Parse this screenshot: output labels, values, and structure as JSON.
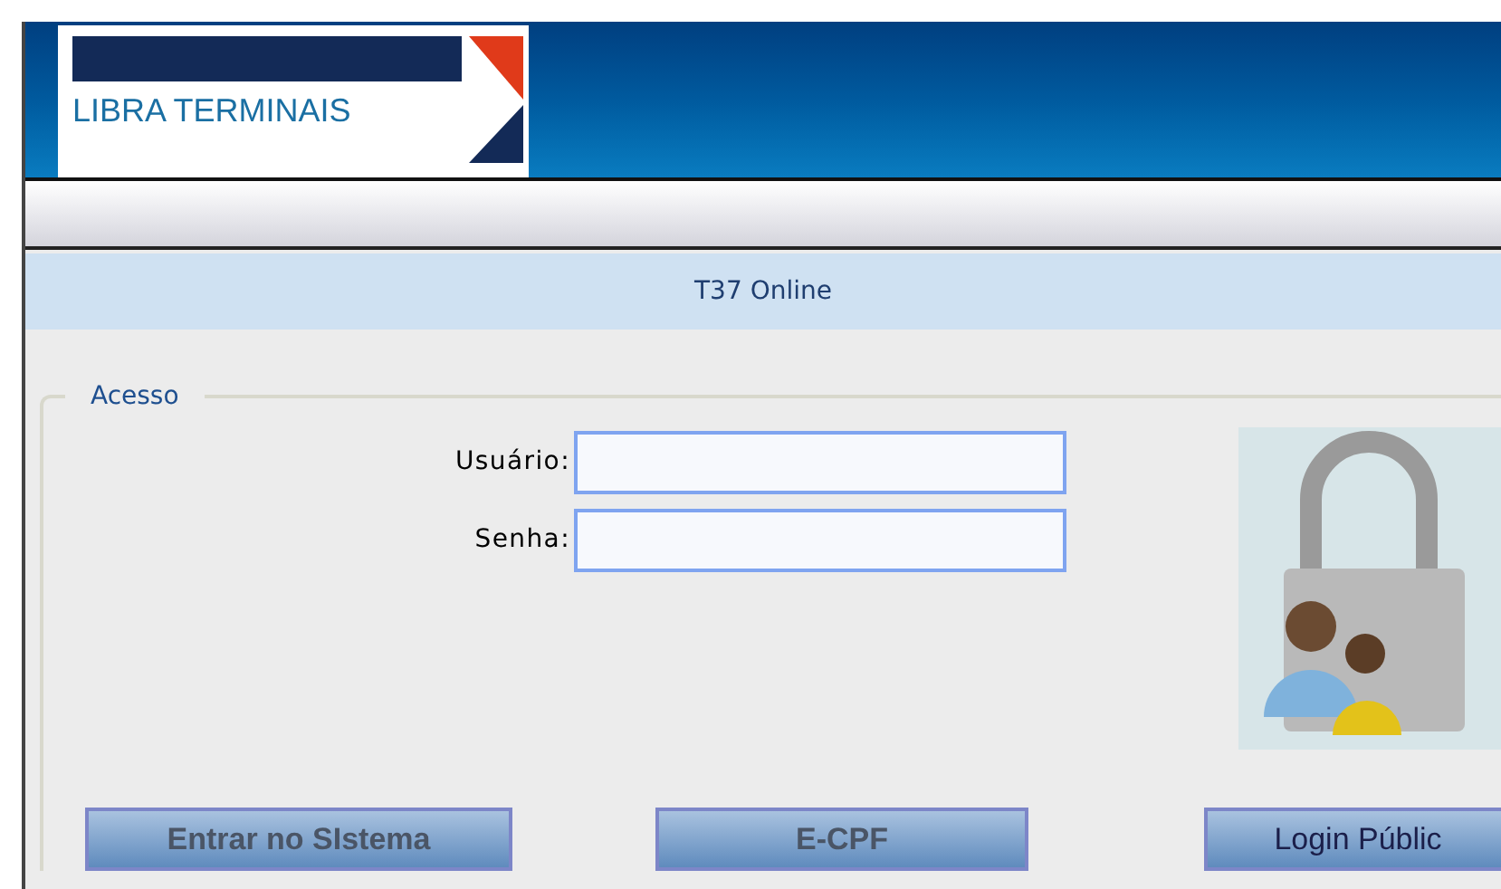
{
  "header": {
    "logo_text": "LIBRA TERMINAIS"
  },
  "title_bar": {
    "title": "T37 Online"
  },
  "login": {
    "legend": "Acesso",
    "fields": [
      {
        "label": "Usuário:"
      },
      {
        "label": "Senha:"
      }
    ]
  },
  "buttons": [
    {
      "label": "Entrar no SIstema",
      "disabled": true
    },
    {
      "label": "E-CPF",
      "disabled": true
    },
    {
      "label": "Login Públic",
      "disabled": false
    }
  ]
}
